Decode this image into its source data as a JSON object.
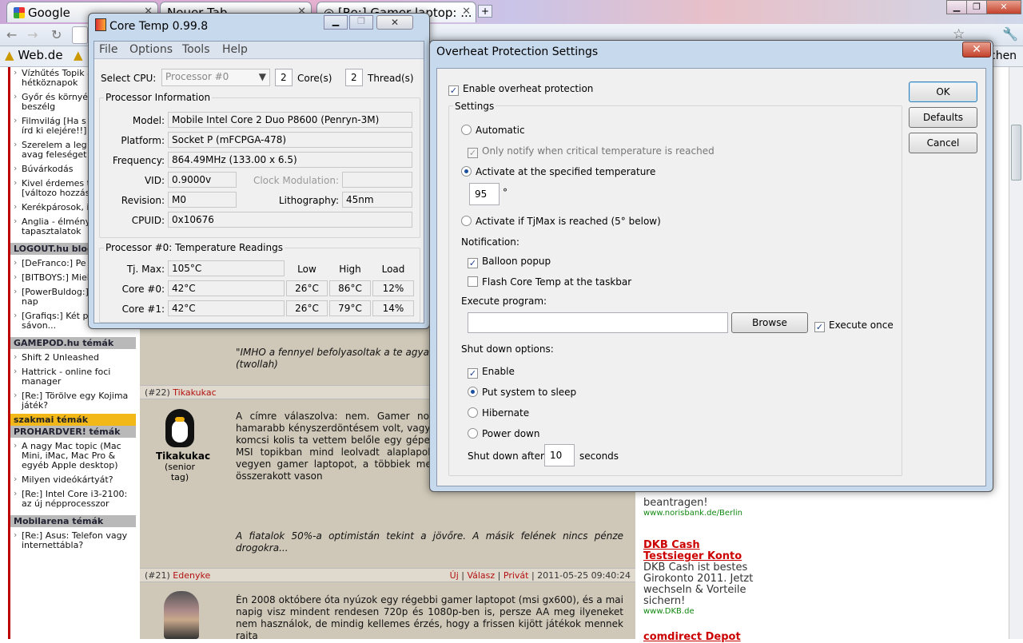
{
  "browser": {
    "tabs": [
      "Google",
      "Neuer Tab",
      "[Re:] Gamer laptop: ..."
    ],
    "bookmark": "Web.de",
    "bookmark_right": "chen"
  },
  "left_sidebar": {
    "items_top": [
      "Vízhűtés Topik a hétköznapok",
      "Győr és környék veszek-beszélg",
      "Filmvilág [Ha s legalább írd ki elejére!!]",
      "Szerelem a leg szinteken avag feleséget keres",
      "Búvárkodás",
      "Kivel érdemes topic... [változo hozzászólás!]",
      "Kerékpárosok, ide!",
      "Anglia - élmény tapasztalatok"
    ],
    "logout_header": "LOGOUT.hu blog",
    "logout_items": [
      "[DeFranco:] Pe",
      "[BITBOYS:] Mielőtt a MOE",
      "[PowerBuldog:] 7 év 2555 nap",
      "[Grafiqs:] Két pont egy sávon..."
    ],
    "gamepod_header": "GAMEPOD.hu témák",
    "gamepod_items": [
      "Shift 2 Unleashed",
      "Hattrick - online foci manager",
      "[Re:] Törölve egy Kojima játék?"
    ],
    "szakmai_header": "szakmai témák",
    "prohardver_header": "PROHARDVER! témák",
    "prohardver_items": [
      "A nagy Mac topic (Mac Mini, iMac, Mac Pro & egyéb Apple desktop)",
      "Milyen videókártyát?",
      "[Re:] Intel Core i3-2100: az új népprocesszor"
    ],
    "mobilarena_header": "Mobilarena témák",
    "mobilarena_items": [
      "[Re:] Asus: Telefon vagy internettábla?"
    ]
  },
  "center": {
    "quote1": "\"IMHO a fennyel befolyasoltak a te agya",
    "quote1_b": "(twollah)",
    "post22_num": "(#22)",
    "post22_user": "Tikakukac",
    "post22_avatar_name": "Tikakukac",
    "post22_rank": "(senior tag)",
    "post22_text": "A címre válaszolva: nem. Gamer notival bu az üzemideje és jó eséllyel hamarabb kényszerdöntésem volt, vagy veszek olya megkenem úgy 200k-val a komcsi kolis ta vettem belőle egy gépet. Még szerencse as sorozatból vettem, MSI topikban mind leolvadt alaplapokról szólt. Akinek nagyon muszáj, az vegyen gamer laptopot, a többiek meg gondolkozzanak el valami rendesen összerakott vason",
    "post22_quote": "A fiatalok 50%-a optimistán tekint a jövőre. A másik felének nincs pénze drogokra...",
    "post21_num": "(#21)",
    "post21_user": "Edenyke",
    "post21_links": [
      "Új",
      "Válasz",
      "Privát"
    ],
    "post21_date": "2011-05-25 09:40:24",
    "post21_text": "Én 2008 októbere óta nyúzok egy régebbi gamer laptopot (msi gx600), és a mai napig visz mindent rendesen 720p és 1080p-ben is, persze AA meg ilyeneket nem használok, de mindig kellemes érzés, hogy a frissen kijött játékok mennek rajta"
  },
  "right_ads": {
    "ad1_tail": "beantragen!",
    "ad1_url": "www.norisbank.de/Berlin",
    "ad2_title": "DKB Cash Testsieger Konto",
    "ad2_text": "DKB Cash ist bestes Girokonto 2011. Jetzt wechseln & Vorteile sichern!",
    "ad2_url": "www.DKB.de",
    "ad3_title": "comdirect Depot"
  },
  "coretemp": {
    "title": "Core Temp 0.99.8",
    "menu": [
      "File",
      "Options",
      "Tools",
      "Help"
    ],
    "select_cpu_label": "Select CPU:",
    "cpu_value": "Processor #0",
    "cores_value": "2",
    "cores_label": "Core(s)",
    "threads_value": "2",
    "threads_label": "Thread(s)",
    "proc_info_title": "Processor Information",
    "model_label": "Model:",
    "model_value": "Mobile Intel Core 2 Duo P8600 (Penryn-3M)",
    "platform_label": "Platform:",
    "platform_value": "Socket P (mFCPGA-478)",
    "frequency_label": "Frequency:",
    "frequency_value": "864.49MHz (133.00 x 6.5)",
    "vid_label": "VID:",
    "vid_value": "0.9000v",
    "clockmod_label": "Clock Modulation:",
    "clockmod_value": "",
    "revision_label": "Revision:",
    "revision_value": "M0",
    "litho_label": "Lithography:",
    "litho_value": "45nm",
    "cpuid_label": "CPUID:",
    "cpuid_value": "0x10676",
    "temps_title": "Processor #0: Temperature Readings",
    "tjmax_label": "Tj. Max:",
    "tjmax_value": "105°C",
    "col_low": "Low",
    "col_high": "High",
    "col_load": "Load",
    "cores": [
      {
        "label": "Core #0:",
        "temp": "42°C",
        "low": "26°C",
        "high": "86°C",
        "load": "12%"
      },
      {
        "label": "Core #1:",
        "temp": "42°C",
        "low": "26°C",
        "high": "79°C",
        "load": "14%"
      }
    ]
  },
  "overheat": {
    "title": "Overheat Protection Settings",
    "enable_label": "Enable overheat protection",
    "settings_label": "Settings",
    "automatic": "Automatic",
    "only_notify": "Only notify when critical temperature is reached",
    "activate_specified": "Activate at the specified temperature",
    "temp_value": "95",
    "degree": "°",
    "activate_tjmax": "Activate if TjMax is reached (5° below)",
    "notification_label": "Notification:",
    "balloon": "Balloon popup",
    "flash": "Flash Core Temp at the taskbar",
    "execute_label": "Execute program:",
    "execute_value": "",
    "browse": "Browse",
    "execute_once": "Execute once",
    "shutdown_label": "Shut down options:",
    "sd_enable": "Enable",
    "sleep": "Put system to sleep",
    "hibernate": "Hibernate",
    "power_down": "Power down",
    "shutdown_after": "Shut down after",
    "shutdown_seconds_value": "10",
    "seconds": "seconds",
    "ok": "OK",
    "defaults": "Defaults",
    "cancel": "Cancel"
  }
}
